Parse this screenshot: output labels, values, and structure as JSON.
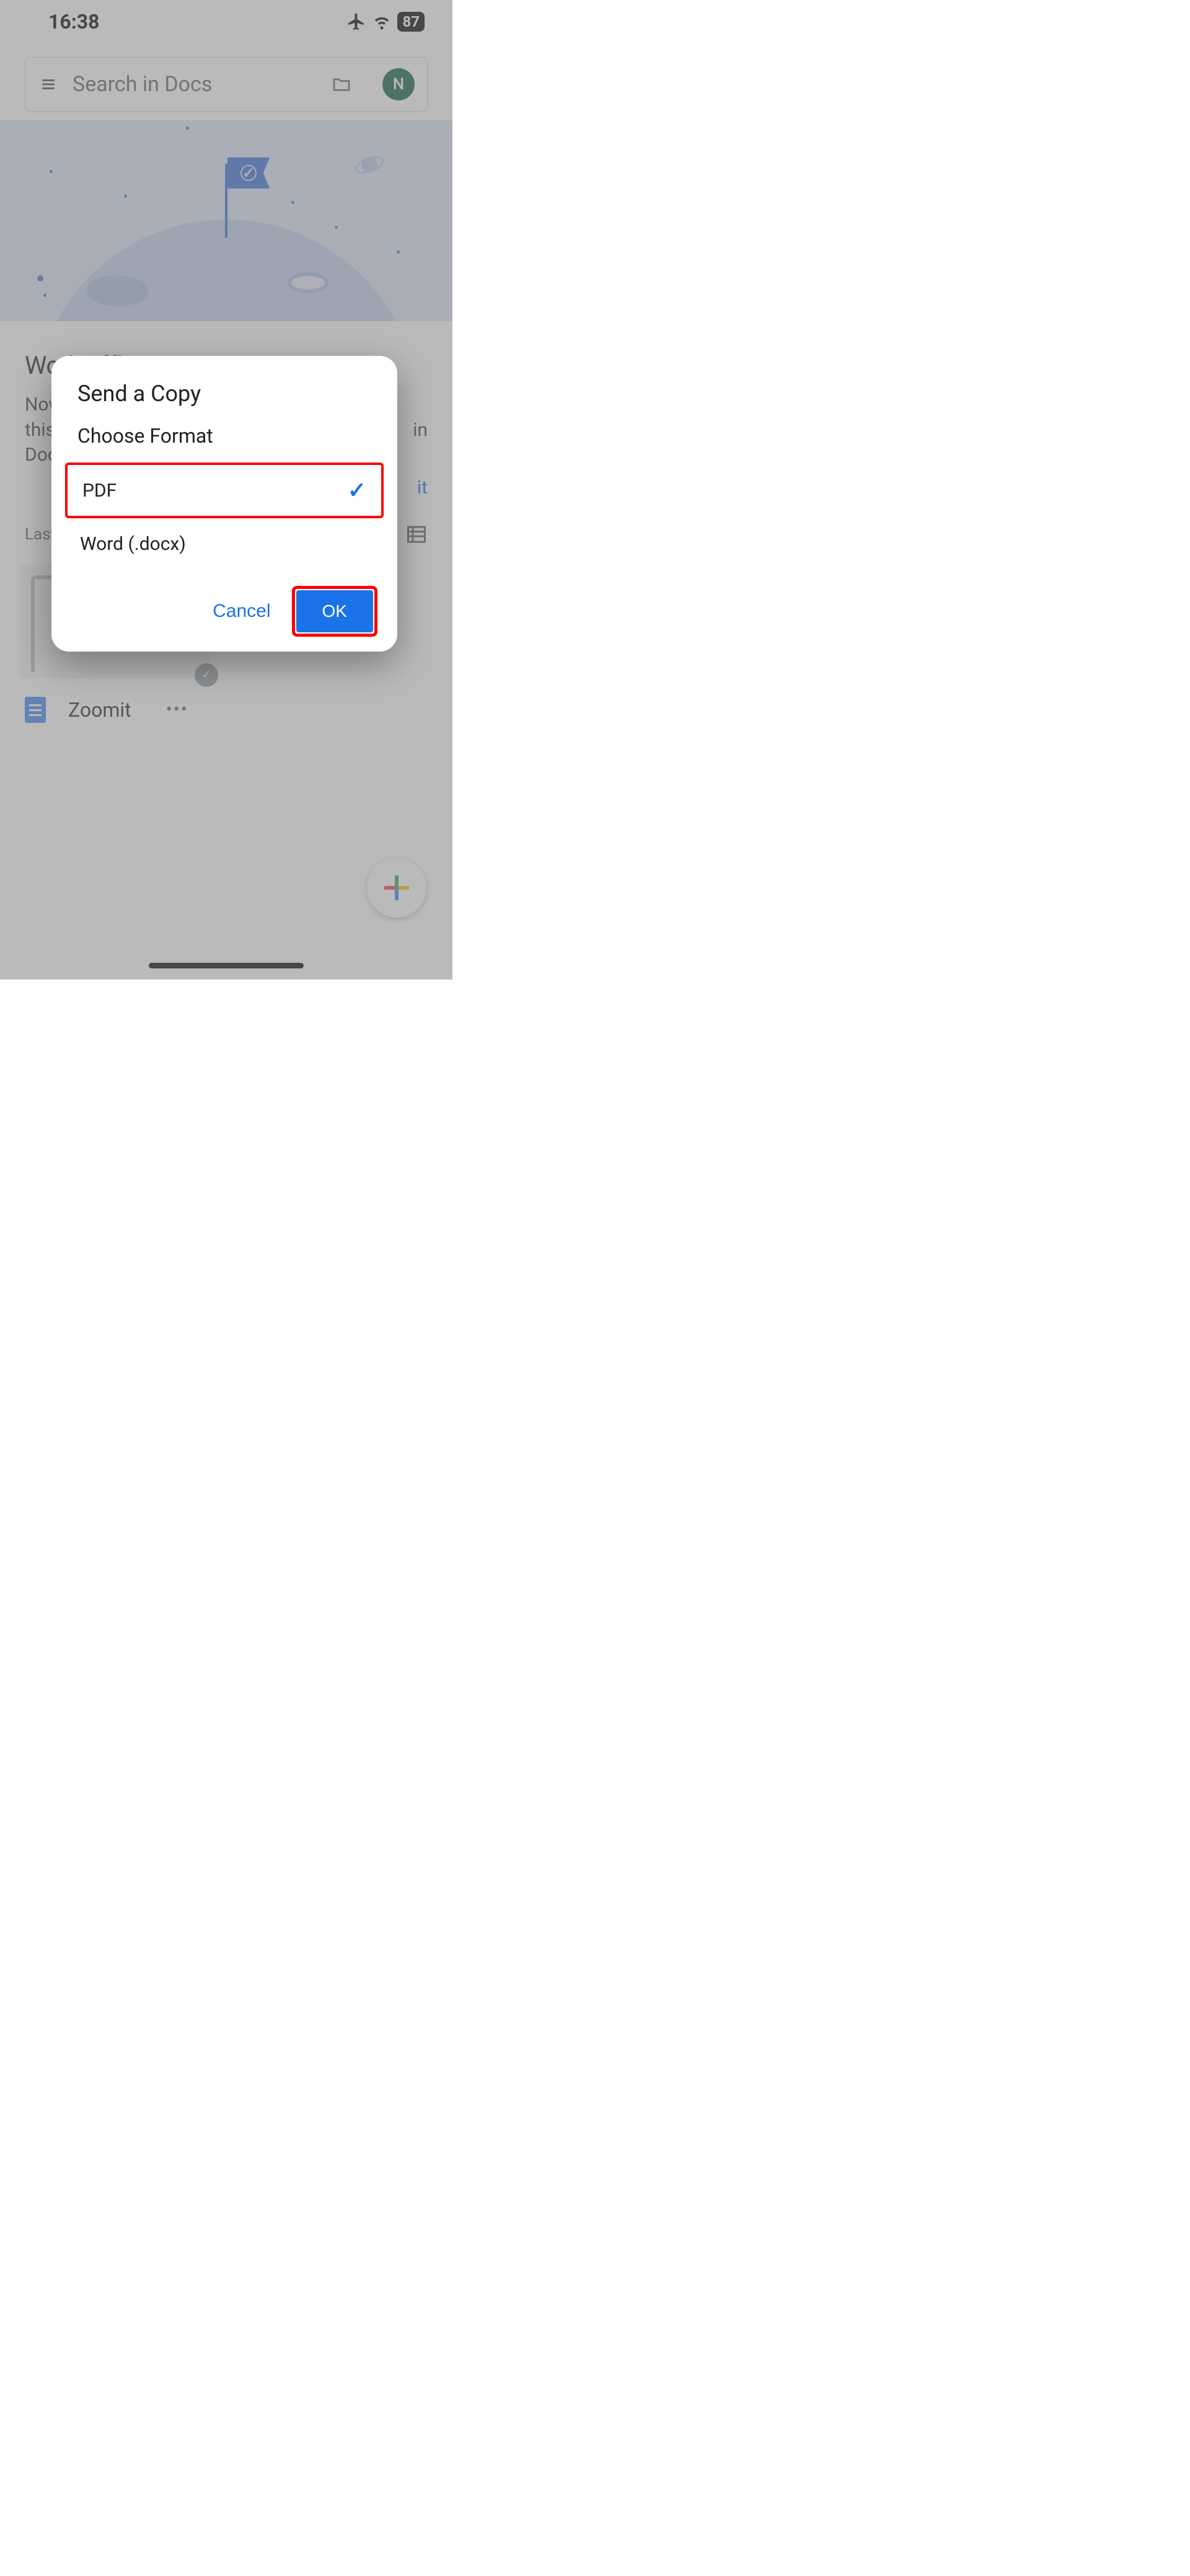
{
  "status": {
    "time": "16:38",
    "battery": "87"
  },
  "search": {
    "placeholder": "Search in Docs",
    "avatar_initial": "N"
  },
  "offline": {
    "title": "Work offline",
    "body_start": "Now",
    "body_mid": "this",
    "body_end": "Doc",
    "body_right": "in",
    "link": "it"
  },
  "list": {
    "header": "Last"
  },
  "docs": [
    {
      "title": "Zoomit"
    }
  ],
  "dialog": {
    "title": "Send a Copy",
    "subtitle": "Choose Format",
    "options": [
      {
        "label": "PDF",
        "selected": true
      },
      {
        "label": "Word (.docx)",
        "selected": false
      }
    ],
    "cancel": "Cancel",
    "ok": "OK"
  }
}
